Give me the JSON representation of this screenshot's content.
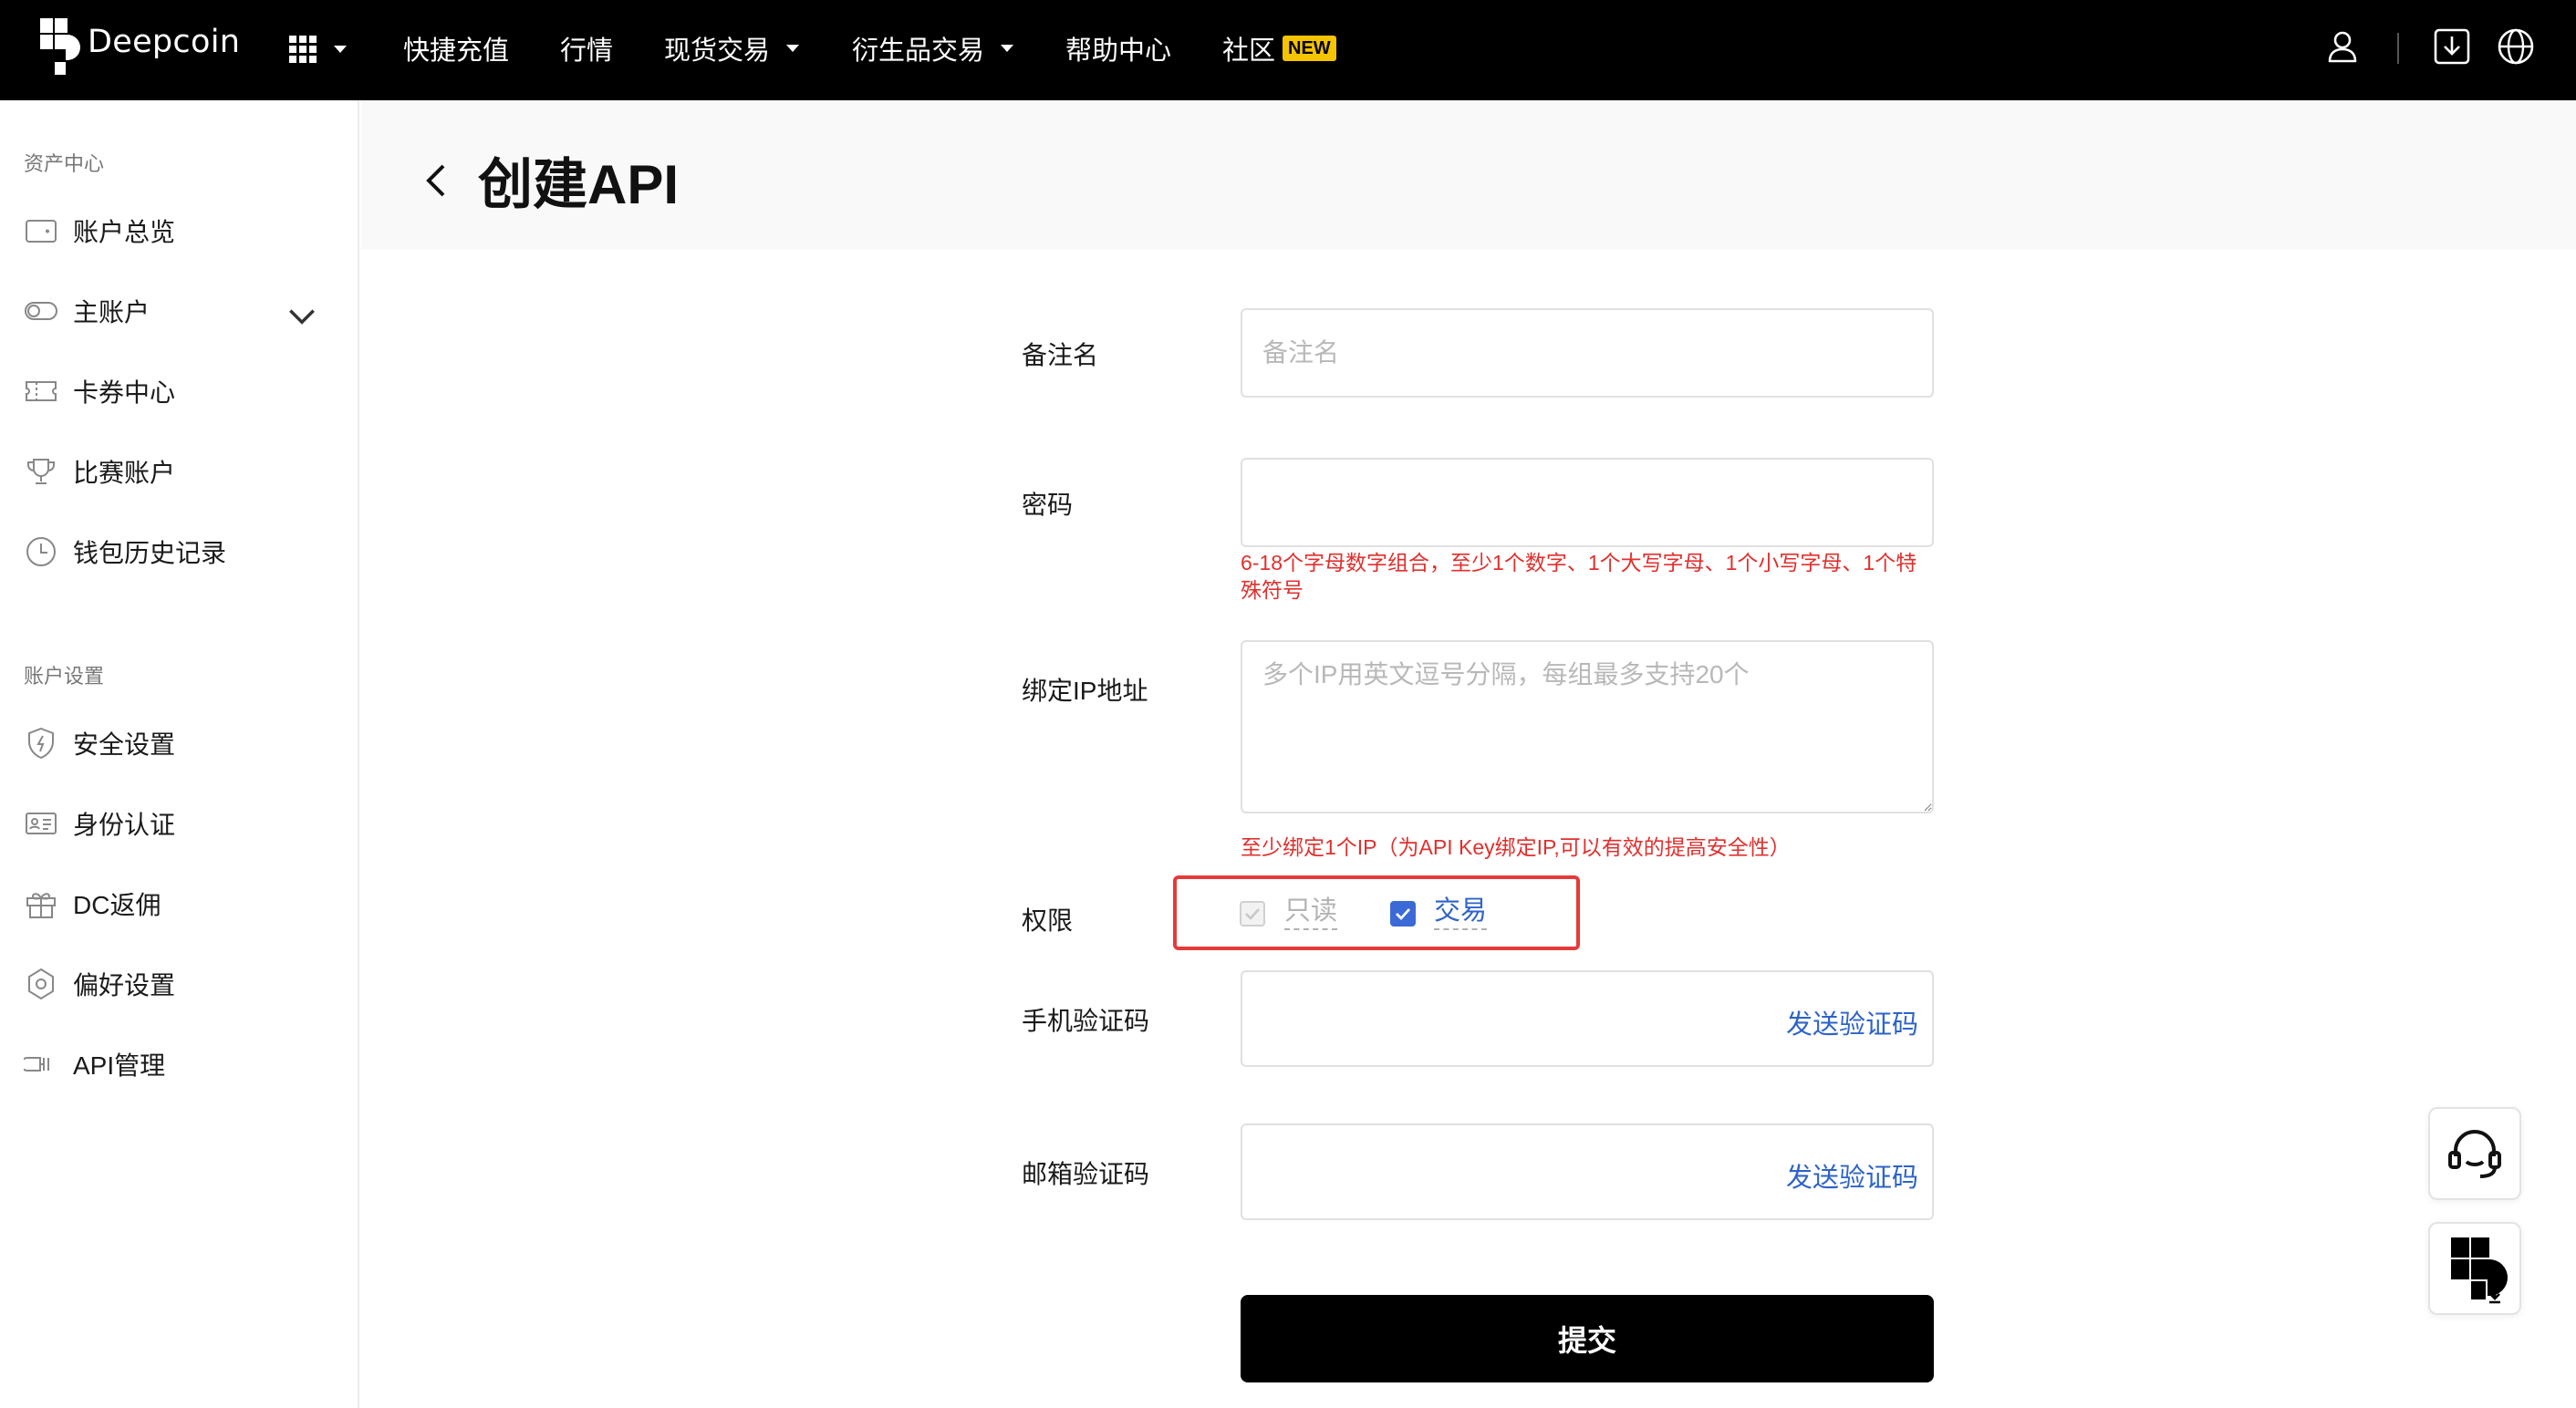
{
  "brand": {
    "name": "Deepcoin"
  },
  "nav": {
    "items": [
      {
        "label": "快捷充值"
      },
      {
        "label": "行情"
      },
      {
        "label": "现货交易"
      },
      {
        "label": "衍生品交易"
      },
      {
        "label": "帮助中心"
      },
      {
        "label": "社区",
        "badge": "NEW"
      }
    ],
    "icons": [
      "apps-grid-icon",
      "user-icon",
      "download-icon",
      "globe-icon"
    ]
  },
  "sidebar": {
    "section_assets": "资产中心",
    "assets_items": [
      {
        "label": "账户总览",
        "icon": "wallet-icon"
      },
      {
        "label": "主账户",
        "icon": "toggle-icon"
      },
      {
        "label": "卡券中心",
        "icon": "ticket-icon"
      },
      {
        "label": "比赛账户",
        "icon": "trophy-icon"
      },
      {
        "label": "钱包历史记录",
        "icon": "clock-icon"
      }
    ],
    "section_settings": "账户设置",
    "settings_items": [
      {
        "label": "安全设置",
        "icon": "shield-icon"
      },
      {
        "label": "身份认证",
        "icon": "id-card-icon"
      },
      {
        "label": "DC返佣",
        "icon": "gift-icon"
      },
      {
        "label": "偏好设置",
        "icon": "settings-icon"
      },
      {
        "label": "API管理",
        "icon": "api-icon"
      }
    ]
  },
  "page": {
    "title": "创建API"
  },
  "form": {
    "remark": {
      "label": "备注名",
      "placeholder": "备注名",
      "value": ""
    },
    "password": {
      "label": "密码",
      "value": "",
      "hint": "6-18个字母数字组合，至少1个数字、1个大写字母、1个小写字母、1个特殊符号"
    },
    "ip": {
      "label": "绑定IP地址",
      "placeholder": "多个IP用英文逗号分隔，每组最多支持20个",
      "value": "",
      "hint": "至少绑定1个IP（为API Key绑定IP,可以有效的提高安全性）"
    },
    "permission": {
      "label": "权限",
      "options": [
        {
          "label": "只读",
          "checked": true,
          "disabled": true
        },
        {
          "label": "交易",
          "checked": true,
          "disabled": false
        }
      ]
    },
    "phone_code": {
      "label": "手机验证码",
      "value": "",
      "send_label": "发送验证码"
    },
    "email_code": {
      "label": "邮箱验证码",
      "value": "",
      "send_label": "发送验证码"
    },
    "submit_label": "提交"
  },
  "colors": {
    "accent": "#3b6ad6",
    "error": "#e0302d",
    "highlight_border": "#e63a3a",
    "badge": "#f5c400"
  }
}
